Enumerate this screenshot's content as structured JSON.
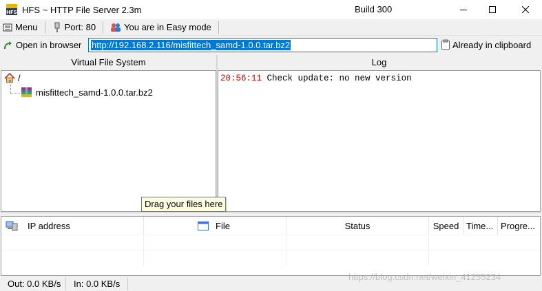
{
  "window": {
    "title": "HFS ~ HTTP File Server 2.3m",
    "build": "Build 300",
    "app_icon_text": "HFS"
  },
  "menubar": {
    "menu_label": "Menu",
    "port_label": "Port: 80",
    "mode_label": "You are in Easy mode"
  },
  "urlbar": {
    "open_browser_label": "Open in browser",
    "url": "http://192.168.2.116/misfittech_samd-1.0.0.tar.bz2",
    "clipboard_status": "Already in clipboard"
  },
  "vfs": {
    "header": "Virtual File System",
    "root_label": "/",
    "file_label": "misfittech_samd-1.0.0.tar.bz2"
  },
  "log": {
    "header": "Log",
    "entries": [
      {
        "time": "20:56:11",
        "message": "Check update: no new version"
      }
    ]
  },
  "tooltip": "Drag your files here",
  "connections": {
    "columns": [
      "IP address",
      "File",
      "Status",
      "Speed",
      "Time...",
      "Progre..."
    ]
  },
  "statusbar": {
    "out": "Out: 0.0 KB/s",
    "in": "In: 0.0 KB/s"
  },
  "watermark": "https://blog.csdn.net/weixin_41255234",
  "colors": {
    "accent": "#0078d7",
    "log_time": "#d40000",
    "tooltip_bg": "#ffffe1"
  }
}
